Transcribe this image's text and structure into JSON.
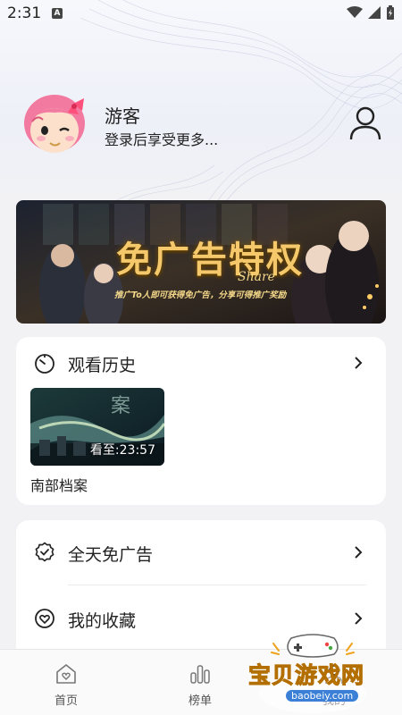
{
  "status_bar": {
    "time": "2:31",
    "notification_icon": "A"
  },
  "profile": {
    "name": "游客",
    "subtitle": "登录后享受更多...",
    "avatar_icon": "cartoon-girl-avatar",
    "account_icon": "person-outline-icon"
  },
  "banner": {
    "title": "免广告特权",
    "script_text": "Share",
    "caption": "推广To人即可获得免广告，分享可得推广奖励"
  },
  "history": {
    "title": "观看历史",
    "items": [
      {
        "title": "南部档案",
        "progress_prefix": "看至:",
        "progress_time": "23:57",
        "thumb_text": "案"
      }
    ]
  },
  "menu": {
    "items": [
      {
        "label": "全天免广告",
        "icon": "verified-badge-icon"
      },
      {
        "label": "我的收藏",
        "icon": "heart-circle-icon"
      }
    ]
  },
  "bottom_nav": {
    "items": [
      {
        "label": "首页",
        "icon": "home-heart-icon"
      },
      {
        "label": "榜单",
        "icon": "bar-chart-icon"
      },
      {
        "label": "我的",
        "icon": "profile-icon"
      }
    ]
  },
  "watermark": {
    "text": "宝贝游戏网",
    "url": "baobeiy.com"
  },
  "colors": {
    "background": "#f2f2f4",
    "card": "#ffffff",
    "text": "#222222",
    "banner_gold": "#f5c96b",
    "watermark_orange": "#f0a21a"
  }
}
